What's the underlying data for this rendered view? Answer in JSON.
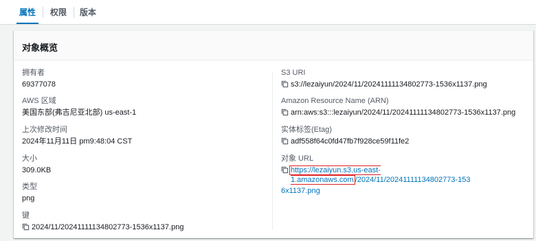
{
  "tabs": [
    {
      "label": "属性",
      "active": true
    },
    {
      "label": "权限",
      "active": false
    },
    {
      "label": "版本",
      "active": false
    }
  ],
  "panel": {
    "title": "对象概览"
  },
  "left_fields": [
    {
      "label": "拥有者",
      "value": "69377078"
    },
    {
      "label": "AWS 区域",
      "value": "美国东部(弗吉尼亚北部) us-east-1"
    },
    {
      "label": "上次修改时间",
      "value": "2024年11月11日 pm9:48:04 CST"
    },
    {
      "label": "大小",
      "value": "309.0KB"
    },
    {
      "label": "类型",
      "value": "png"
    },
    {
      "label": "键",
      "value": "2024/11/20241111134802773-1536x1137.png"
    }
  ],
  "right_fields": [
    {
      "label": "S3 URI",
      "value": "s3://lezaiyun/2024/11/20241111134802773-1536x1137.png"
    },
    {
      "label": "Amazon Resource Name (ARN)",
      "value": "arn:aws:s3:::lezaiyun/2024/11/20241111134802773-1536x1137.png"
    },
    {
      "label": "实体标签(Etag)",
      "value": "adf558f64c0fd47fb7f928ce59f11fe2"
    },
    {
      "label": "对象 URL",
      "url_highlighted": "https://lezaiyun.s3.us-east-1.amazonaws.com",
      "url_rest_line1": "/2024/11/20241111134802773-153",
      "url_rest_line2": "6x1137.png"
    }
  ],
  "colors": {
    "accent": "#0073bb",
    "highlight_border": "#e02020"
  },
  "icons": {
    "copy": "copy-icon"
  }
}
